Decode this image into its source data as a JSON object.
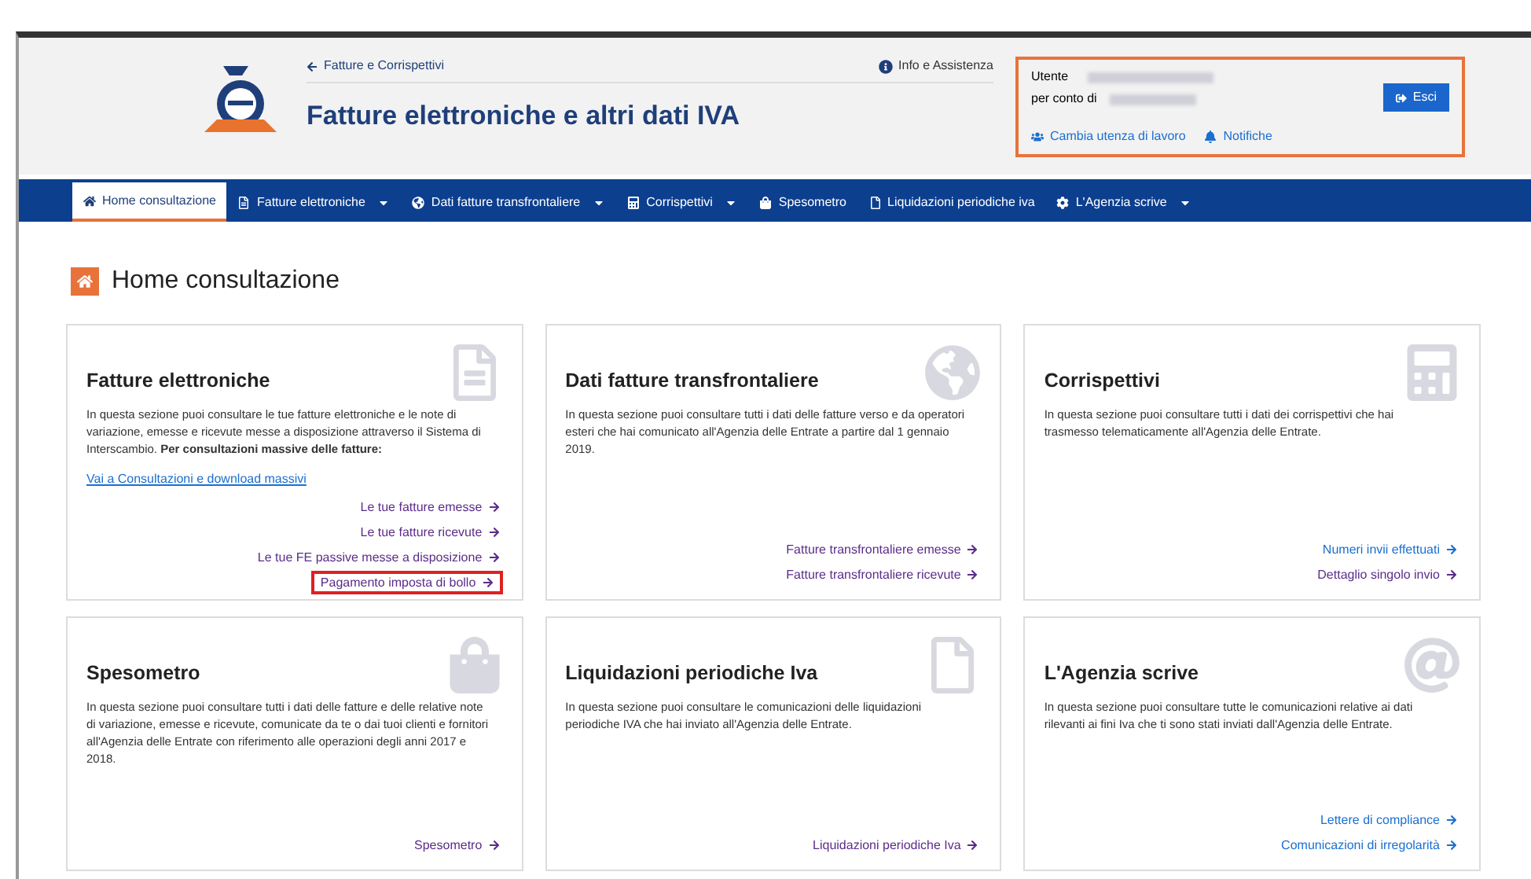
{
  "header": {
    "breadcrumb": "Fatture e Corrispettivi",
    "title": "Fatture elettroniche e altri dati IVA",
    "help": "Info e Assistenza"
  },
  "user_box": {
    "user_label": "Utente",
    "on_behalf_label": "per conto di",
    "logout_button": "Esci",
    "change_user": "Cambia utenza di lavoro",
    "notifications": "Notifiche"
  },
  "nav": [
    {
      "label": "Home consultazione",
      "selected": true,
      "dropdown": false
    },
    {
      "label": "Fatture elettroniche",
      "selected": false,
      "dropdown": true
    },
    {
      "label": "Dati fatture transfrontaliere",
      "selected": false,
      "dropdown": true
    },
    {
      "label": "Corrispettivi",
      "selected": false,
      "dropdown": true
    },
    {
      "label": "Spesometro",
      "selected": false,
      "dropdown": false
    },
    {
      "label": "Liquidazioni periodiche iva",
      "selected": false,
      "dropdown": false
    },
    {
      "label": "L'Agenzia scrive",
      "selected": false,
      "dropdown": true
    }
  ],
  "page_title": "Home consultazione",
  "cards": [
    {
      "title": "Fatture elettroniche",
      "text": "In questa sezione puoi consultare le tue fatture elettroniche e le note di variazione, emesse e ricevute messe a disposizione attraverso il Sistema di Interscambio. **Per consultazioni massive delle fatture:**",
      "inline_link": "Vai a Consultazioni e download massivi",
      "links": [
        {
          "label": "Le tue fatture emesse",
          "visited": true,
          "highlighted": false
        },
        {
          "label": "Le tue fatture ricevute",
          "visited": true,
          "highlighted": false
        },
        {
          "label": "Le tue FE passive messe a disposizione",
          "visited": true,
          "highlighted": false
        },
        {
          "label": "Pagamento imposta di bollo",
          "visited": true,
          "highlighted": true
        }
      ]
    },
    {
      "title": "Dati fatture transfrontaliere",
      "text": "In questa sezione puoi consultare tutti i dati delle fatture verso e da operatori esteri che hai comunicato all'Agenzia delle Entrate a partire dal 1 gennaio 2019.",
      "links": [
        {
          "label": "Fatture transfrontaliere emesse",
          "visited": true,
          "highlighted": false
        },
        {
          "label": "Fatture transfrontaliere ricevute",
          "visited": true,
          "highlighted": false
        }
      ]
    },
    {
      "title": "Corrispettivi",
      "text": "In questa sezione puoi consultare tutti i dati dei corrispettivi che hai trasmesso telematicamente all'Agenzia delle Entrate.",
      "links": [
        {
          "label": "Numeri invii effettuati",
          "visited": false,
          "highlighted": false
        },
        {
          "label": "Dettaglio singolo invio",
          "visited": true,
          "highlighted": false
        }
      ]
    },
    {
      "title": "Spesometro",
      "text": "In questa sezione puoi consultare tutti i dati delle fatture e delle relative note di variazione, emesse e ricevute, comunicate da te o dai tuoi clienti e fornitori all'Agenzia delle Entrate con riferimento alle operazioni degli anni 2017 e 2018.",
      "links": [
        {
          "label": "Spesometro",
          "visited": true,
          "highlighted": false
        }
      ]
    },
    {
      "title": "Liquidazioni periodiche Iva",
      "text": "In questa sezione puoi consultare le comunicazioni delle liquidazioni periodiche IVA che hai inviato all'Agenzia delle Entrate.",
      "links": [
        {
          "label": "Liquidazioni periodiche Iva",
          "visited": true,
          "highlighted": false
        }
      ]
    },
    {
      "title": "L'Agenzia scrive",
      "text": "In questa sezione puoi consultare tutte le comunicazioni relative ai dati rilevanti ai fini Iva che ti sono stati inviati dall'Agenzia delle Entrate.",
      "links": [
        {
          "label": "Lettere di compliance",
          "visited": false,
          "highlighted": false
        },
        {
          "label": "Comunicazioni di irregolarità",
          "visited": false,
          "highlighted": false
        }
      ]
    }
  ]
}
